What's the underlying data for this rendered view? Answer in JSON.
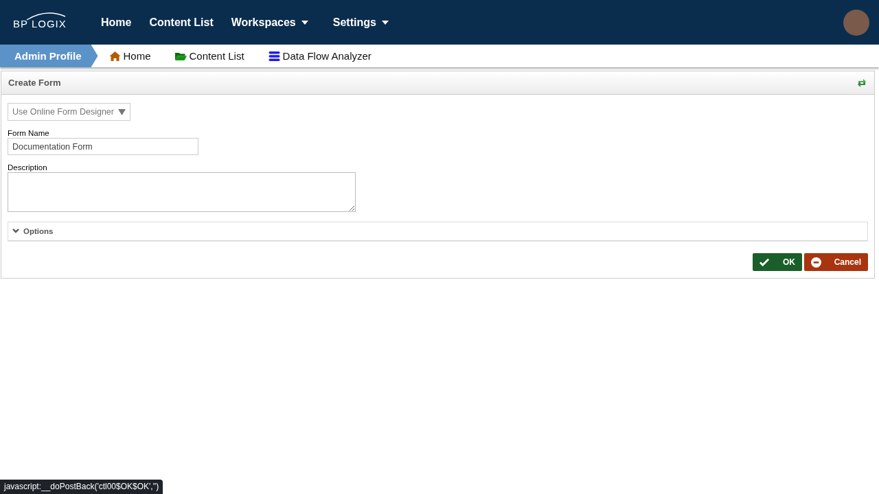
{
  "header": {
    "logo": "BP LOGIX",
    "nav": [
      {
        "label": "Home",
        "has_menu": false
      },
      {
        "label": "Content List",
        "has_menu": false
      },
      {
        "label": "Workspaces",
        "has_menu": true
      },
      {
        "label": "Settings",
        "has_menu": true
      }
    ]
  },
  "breadcrumb": {
    "current": "Admin Profile",
    "links": [
      {
        "label": "Home",
        "kind": "home"
      },
      {
        "label": "Content List",
        "kind": "folder"
      },
      {
        "label": "Data Flow Analyzer",
        "kind": "database"
      }
    ]
  },
  "panel": {
    "title": "Create Form",
    "designer_select": "Use Online Form Designer",
    "form_name": {
      "label": "Form Name",
      "value": "Documentation Form"
    },
    "description": {
      "label": "Description"
    },
    "options": {
      "label": "Options",
      "expanded": false
    },
    "buttons": [
      {
        "label": "OK",
        "kind": "ok"
      },
      {
        "label": "Cancel",
        "kind": "cancel"
      }
    ]
  },
  "status_bar": "javascript:__doPostBack('ctl00$OK$OK','')"
}
